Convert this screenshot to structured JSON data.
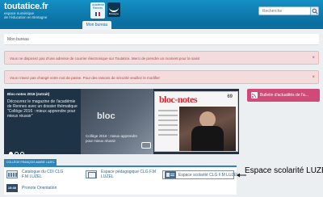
{
  "header": {
    "logo_title": "toutatice.fr",
    "logo_sub1": "espace numérique",
    "logo_sub2": "de l'éducation en Bretagne",
    "partner1_text": "académie Rennes",
    "partner2_text": "Bretagne",
    "search_placeholder": "Recherche"
  },
  "nav": {
    "active_tab": "Mon bureau"
  },
  "breadcrumb": "Mon bureau",
  "alerts": [
    {
      "text": "Vous ne disposez pas d'une adresse de courrier électronique sur Toutatice. Merci de prendre un moment pour la saisir",
      "close": "×"
    },
    {
      "text": "Vous n'avez pas changé votre mot de passe. Pour des raisons de sécurité veuillez le modifier",
      "close": "×"
    }
  ],
  "banner": {
    "heading": "Bloc-notes 2016 (extrait)",
    "text": "Découvrez le magazine de l'académie de Rennes avec un dossier thématique \"Collège 2016 : mieux apprendre pour mieux réussir\"",
    "dots": [
      true,
      false,
      false
    ],
    "mid_title": "bloc",
    "mid_caption": "Collège 2016 : mieux apprendre pour mieux réussir",
    "magazine_title": "bloc-notes",
    "magazine_number": "69"
  },
  "bulletin": {
    "label": "Bulletin d'actualités de l'a..."
  },
  "services": {
    "section_title": "COLLÈGE FRANÇOIS-MARIE LUZEL",
    "items": [
      {
        "label_1": "Catalogue du CDI CLG",
        "label_2": "F.M LUZEL",
        "icon": "shelf-icon"
      },
      {
        "label_1": "Espace pédagogique CLG F.M",
        "label_2": "LUZEL",
        "icon": "books-icon"
      },
      {
        "label_1": "Espace scolarité CLG F.M LUZEL",
        "label_2": "",
        "icon": "id-card-icon"
      },
      {
        "label_1": "Pronote Orientation",
        "label_2": "",
        "icon": "calendar-icon",
        "icon_text": "15:30"
      }
    ]
  },
  "callout": "Espace scolarité LUZEL",
  "colors": {
    "header_blue": "#0b6fa1",
    "alert_bg": "#f4dcdc",
    "bulletin_pink": "#cf4a76",
    "highlight": "#e86b5a"
  }
}
